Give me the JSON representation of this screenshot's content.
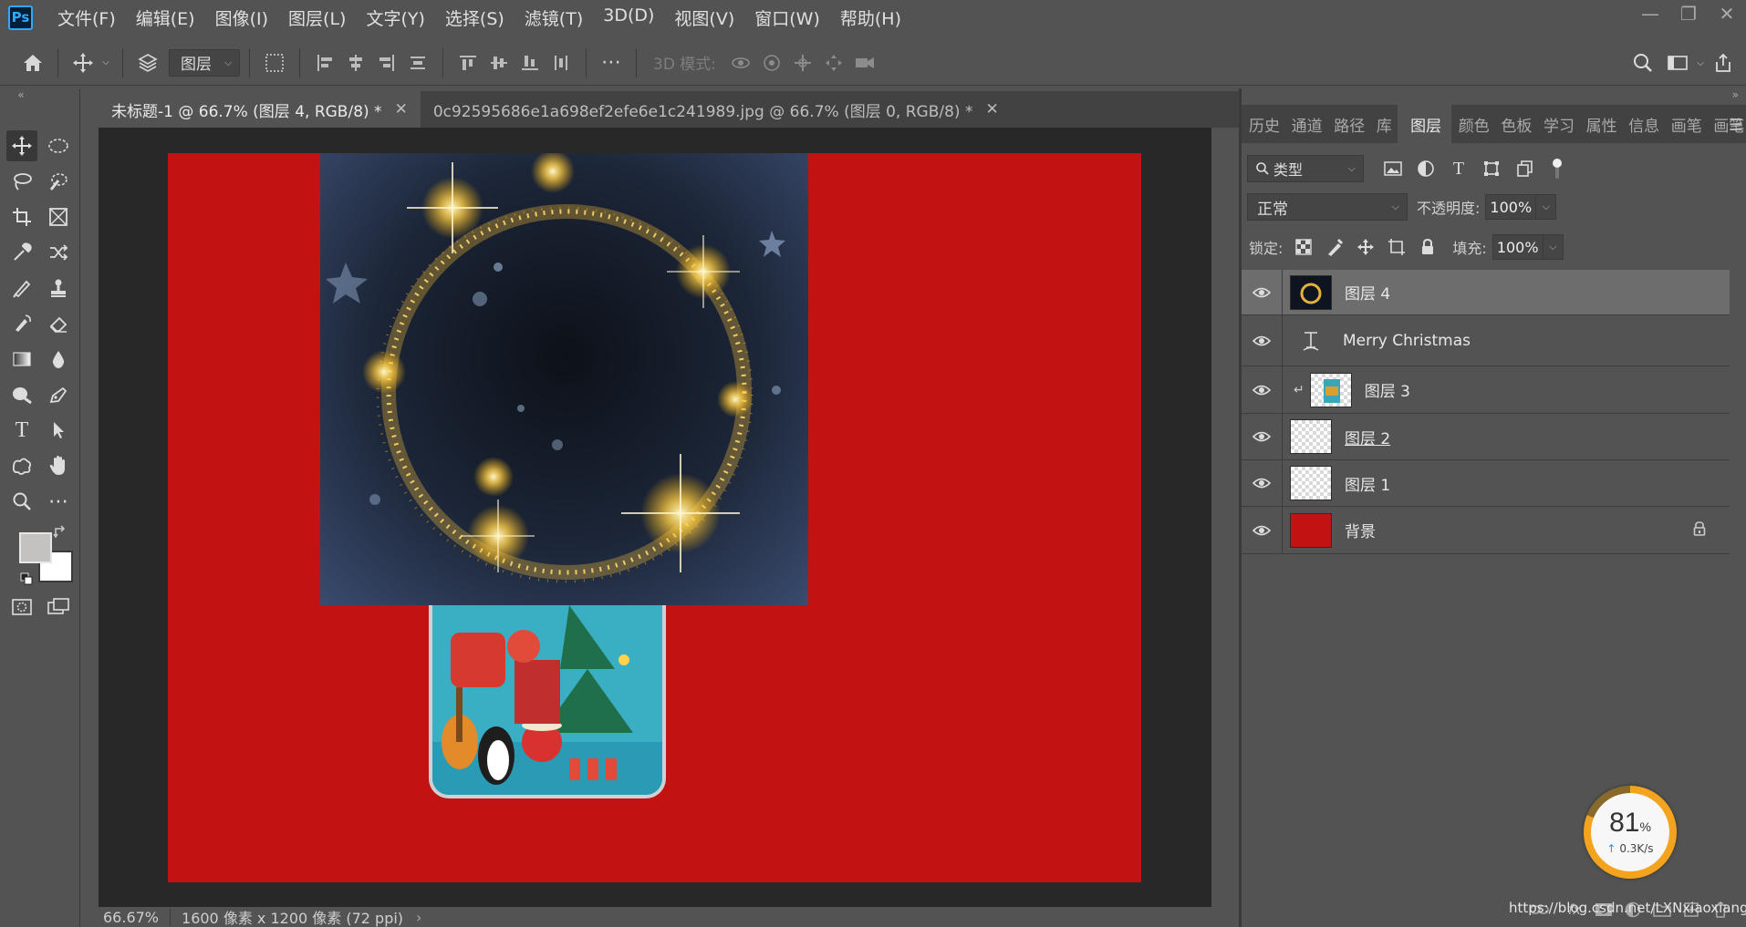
{
  "app": {
    "logo": "Ps",
    "menus": [
      "文件(F)",
      "编辑(E)",
      "图像(I)",
      "图层(L)",
      "文字(Y)",
      "选择(S)",
      "滤镜(T)",
      "3D(D)",
      "视图(V)",
      "窗口(W)",
      "帮助(H)"
    ],
    "window_controls": [
      "minimize-icon",
      "restore-icon",
      "close-icon"
    ]
  },
  "options_bar": {
    "layer_select": "图层",
    "mode_3d_label": "3D 模式:"
  },
  "documents": {
    "tabs": [
      {
        "label": "未标题-1 @ 66.7% (图层 4, RGB/8) *",
        "active": true
      },
      {
        "label": "0c92595686e1a698ef2efe6e1c241989.jpg @ 66.7% (图层 0, RGB/8) *",
        "active": false
      }
    ],
    "close_glyph": "✕"
  },
  "canvas": {
    "background_color": "#c31212"
  },
  "status": {
    "zoom": "66.67%",
    "doc_info": "1600 像素 x 1200 像素 (72 ppi)",
    "chevron": "›"
  },
  "panel": {
    "tabs": [
      "历史",
      "通道",
      "路径",
      "库",
      "图层",
      "颜色",
      "色板",
      "学习",
      "属性",
      "信息",
      "画笔",
      "画笔"
    ],
    "active_tab": "图层",
    "filter_label": "类型",
    "blend_mode": "正常",
    "opacity_label": "不透明度:",
    "opacity_value": "100%",
    "lock_label": "锁定:",
    "fill_label": "填充:",
    "fill_value": "100%",
    "layers": [
      {
        "name": "图层 4",
        "selected": true,
        "type": "image"
      },
      {
        "name": "Merry Christmas",
        "selected": false,
        "type": "text"
      },
      {
        "name": "图层 3",
        "selected": false,
        "type": "clipped"
      },
      {
        "name": "图层 2",
        "selected": false,
        "type": "image",
        "underline": true
      },
      {
        "name": "图层 1",
        "selected": false,
        "type": "image"
      },
      {
        "name": "背景",
        "selected": false,
        "type": "background",
        "locked": true
      }
    ],
    "footer_fx": "fx"
  },
  "watermark": "https://blog.csdn.net/LXNxiaoxiang",
  "speed_widget": {
    "percent": "81",
    "percent_sign": "%",
    "rate": "0.3K/s",
    "fill_fraction": 0.81
  }
}
